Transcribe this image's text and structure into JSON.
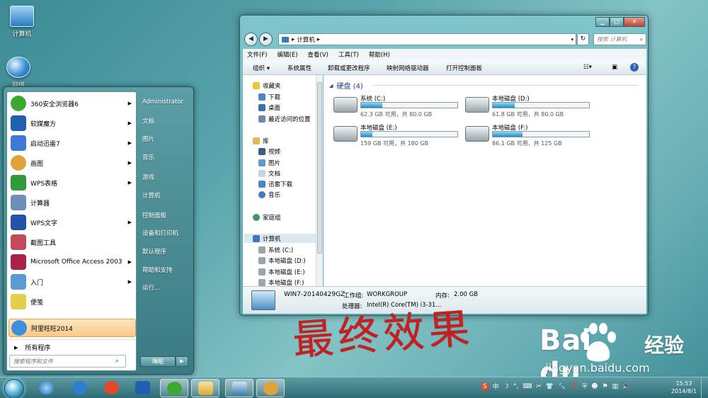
{
  "desktop": {
    "icons": [
      {
        "label": "计算机"
      },
      {
        "label": "网络"
      }
    ]
  },
  "start_menu": {
    "programs": [
      {
        "label": "360安全浏览器6",
        "has_submenu": true,
        "color": "#3ea72f"
      },
      {
        "label": "软媒魔方",
        "has_submenu": true,
        "color": "#1f5fb0"
      },
      {
        "label": "启动迅雷7",
        "has_submenu": true,
        "color": "#3c7bd3"
      },
      {
        "label": "画图",
        "has_submenu": true,
        "color": "#e0a33b"
      },
      {
        "label": "WPS表格",
        "has_submenu": true,
        "color": "#2f9a3b"
      },
      {
        "label": "计算器",
        "has_submenu": false,
        "color": "#6b8fb8"
      },
      {
        "label": "WPS文字",
        "has_submenu": true,
        "color": "#2352a8"
      },
      {
        "label": "截图工具",
        "has_submenu": false,
        "color": "#c24a5a"
      },
      {
        "label": "Microsoft Office Access 2003",
        "has_submenu": true,
        "color": "#a8224a"
      },
      {
        "label": "入门",
        "has_submenu": true,
        "color": "#5a9bd5"
      },
      {
        "label": "便笺",
        "has_submenu": false,
        "color": "#e2d04a"
      },
      {
        "label": "阿里旺旺2014",
        "has_submenu": false,
        "color": "#3d8fdc"
      }
    ],
    "all_programs": "所有程序",
    "search_placeholder": "搜索程序和文件",
    "right_items": [
      {
        "label": "Administrator"
      },
      {
        "label": "文档"
      },
      {
        "label": "图片"
      },
      {
        "label": "音乐"
      },
      {
        "label": "游戏"
      },
      {
        "label": "计算机"
      },
      {
        "label": "控制面板"
      },
      {
        "label": "设备和打印机"
      },
      {
        "label": "默认程序"
      },
      {
        "label": "帮助和支持"
      },
      {
        "label": "运行..."
      }
    ],
    "shutdown": "睡眠"
  },
  "explorer": {
    "address": "计算机",
    "search_placeholder": "搜索 计算机",
    "menu": [
      "文件(F)",
      "编辑(E)",
      "查看(V)",
      "工具(T)",
      "帮助(H)"
    ],
    "toolbar": [
      "组织 ▾",
      "系统属性",
      "卸载或更改程序",
      "映射网络驱动器",
      "打开控制面板"
    ],
    "nav": {
      "favorites": {
        "title": "收藏夹",
        "items": [
          "下载",
          "桌面",
          "最近访问的位置"
        ]
      },
      "libraries": {
        "title": "库",
        "items": [
          "视频",
          "图片",
          "文档",
          "迅雷下载",
          "音乐"
        ]
      },
      "homegroup": "家庭组",
      "computer": {
        "title": "计算机",
        "items": [
          "系统 (C:)",
          "本地磁盘 (D:)",
          "本地磁盘 (E:)",
          "本地磁盘 (F:)"
        ]
      }
    },
    "group_title": "硬盘 (4)",
    "drives": [
      {
        "name": "系统 (C:)",
        "size": "62.3 GB 可用，共 80.0 GB",
        "used_fraction": 0.22
      },
      {
        "name": "本地磁盘 (D:)",
        "size": "61.8 GB 可用，共 80.0 GB",
        "used_fraction": 0.23
      },
      {
        "name": "本地磁盘 (E:)",
        "size": "159 GB 可用，共 180 GB",
        "used_fraction": 0.12
      },
      {
        "name": "本地磁盘 (F:)",
        "size": "86.1 GB 可用，共 125 GB",
        "used_fraction": 0.31
      }
    ],
    "details": {
      "pc_name": "WIN7-20140429GZ",
      "workgroup_label": "工作组:",
      "workgroup": "WORKGROUP",
      "memory_label": "内存:",
      "memory": "2.00 GB",
      "cpu_label": "处理器:",
      "cpu": "Intel(R) Core(TM) i3-31..."
    }
  },
  "watermark": {
    "final_effect": "最终效果",
    "baidu_word": "Bai du",
    "baidu_cn": "经验",
    "url": "jingyan.baidu.com"
  },
  "taskbar": {
    "clock_time": "15:53",
    "clock_date": "2014/8/1",
    "tray": [
      "S",
      "中",
      "☽",
      "°,",
      "⌨",
      "✂",
      "👕",
      "🔧"
    ]
  }
}
